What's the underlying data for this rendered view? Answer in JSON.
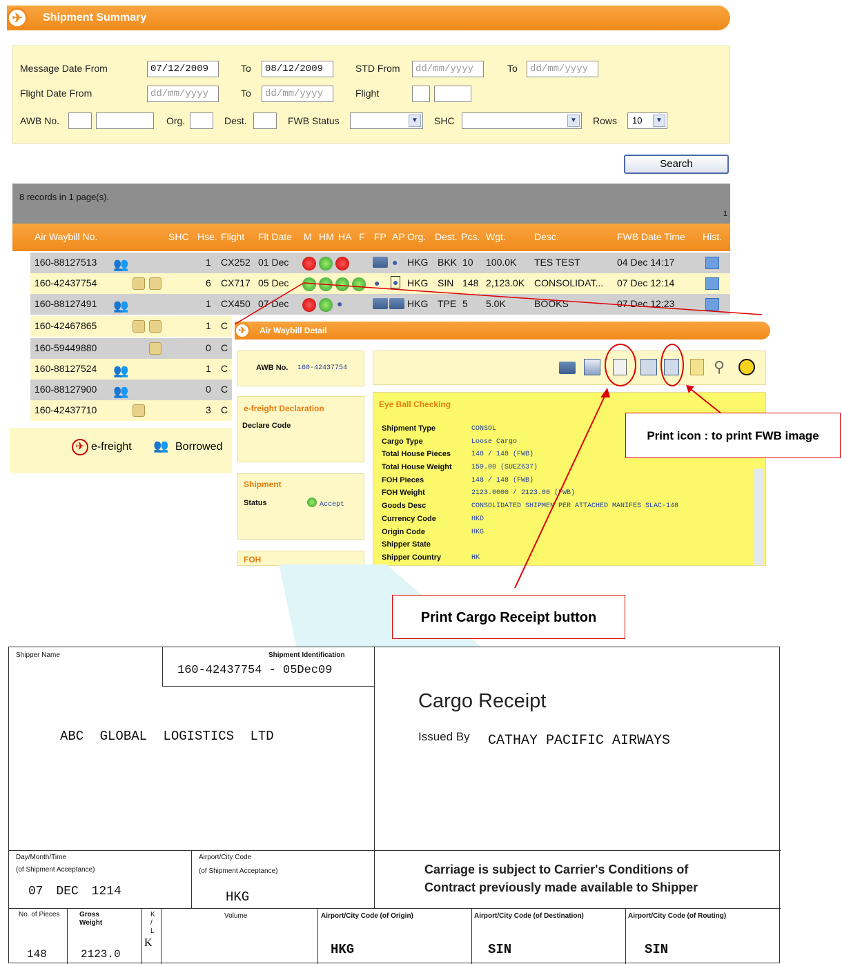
{
  "summary": {
    "title": "Shipment Summary",
    "filters": {
      "message_date_from_label": "Message Date From",
      "message_date_from": "07/12/2009",
      "to1_label": "To",
      "message_date_to": "08/12/2009",
      "std_from_label": "STD From",
      "date_placeholder": "dd/mm/yyyy",
      "to2_label": "To",
      "flight_date_from_label": "Flight Date From",
      "to3_label": "To",
      "flight_label": "Flight",
      "awb_no_label": "AWB No.",
      "org_label": "Org.",
      "dest_label": "Dest.",
      "fwb_status_label": "FWB Status",
      "shc_label": "SHC",
      "rows_label": "Rows",
      "rows_value": "10"
    },
    "search_label": "Search",
    "records_text": "8 records in 1 page(s).",
    "page_number": "1",
    "columns": [
      "Air Waybill No.",
      "SHC",
      "Hse.",
      "Flight",
      "Flt Date",
      "M",
      "HM",
      "HA",
      "F",
      "FP",
      "AP",
      "Org.",
      "Dest.",
      "Pcs.",
      "Wgt.",
      "Desc.",
      "FWB Date Time",
      "Hist."
    ],
    "rows": [
      {
        "awb": "160-88127513",
        "hse": "1",
        "flight": "CX252",
        "date": "01 Dec",
        "org": "HKG",
        "dest": "BKK",
        "pcs": "10",
        "wgt": "100.0K",
        "desc": "TES TEST",
        "fwb": "04 Dec 14:17"
      },
      {
        "awb": "160-42437754",
        "hse": "6",
        "flight": "CX717",
        "date": "05 Dec",
        "org": "HKG",
        "dest": "SIN",
        "pcs": "148",
        "wgt": "2,123.0K",
        "desc": "CONSOLIDAT...",
        "fwb": "07 Dec 12:14"
      },
      {
        "awb": "160-88127491",
        "hse": "1",
        "flight": "CX450",
        "date": "07 Dec",
        "org": "HKG",
        "dest": "TPE",
        "pcs": "5",
        "wgt": "5.0K",
        "desc": "BOOKS",
        "fwb": "07 Dec 12:23"
      },
      {
        "awb": "160-42467865",
        "hse": "1",
        "flight": "C"
      },
      {
        "awb": "160-59449880",
        "hse": "0",
        "flight": "C"
      },
      {
        "awb": "160-88127524",
        "hse": "1",
        "flight": "C"
      },
      {
        "awb": "160-88127900",
        "hse": "0",
        "flight": "C"
      },
      {
        "awb": "160-42437710",
        "hse": "3",
        "flight": "C"
      }
    ],
    "legend": {
      "efreight": "e-freight",
      "borrowed": "Borrowed"
    }
  },
  "detail": {
    "title": "Air Waybill Detail",
    "awb_label": "AWB No.",
    "awb_value": "160-42437754",
    "efreight_title": "e-freight Declaration",
    "declare_code_label": "Declare Code",
    "shipment_title": "Shipment",
    "status_label": "Status",
    "status_value": "Accept",
    "foh_title": "FOH",
    "eyeball_title": "Eye Ball Checking",
    "fields": [
      {
        "label": "Shipment Type",
        "value": "CONSOL"
      },
      {
        "label": "Cargo Type",
        "value": "Loose Cargo"
      },
      {
        "label": "Total House Pieces",
        "value": "148 / 148 (FWB)"
      },
      {
        "label": "Total House Weight",
        "value": "159.00 (SUEZ637)"
      },
      {
        "label": "FOH Pieces",
        "value": "148 / 148 (FWB)"
      },
      {
        "label": "FOH Weight",
        "value": "2123.0000 / 2123.00 (FWB)"
      },
      {
        "label": "Goods Desc",
        "value": "CONSOLIDATED SHIPMEN PER ATTACHED MANIFES SLAC-148"
      },
      {
        "label": "Currency Code",
        "value": "HKD"
      },
      {
        "label": "Origin Code",
        "value": "HKG"
      },
      {
        "label": "Shipper State",
        "value": ""
      },
      {
        "label": "Shipper Country",
        "value": "HK"
      }
    ]
  },
  "annotations": {
    "print_icon_note": "Print icon : to print FWB image",
    "print_receipt_note": "Print Cargo Receipt button"
  },
  "receipt": {
    "shipper_name_label": "Shipper Name",
    "shipment_id_label": "Shipment Identification",
    "shipment_id": "160-42437754 - 05Dec09",
    "shipper_name": "ABC GLOBAL LOGISTICS LTD",
    "title": "Cargo Receipt",
    "issued_by_label": "Issued By",
    "issued_by": "CATHAY PACIFIC AIRWAYS",
    "day_label": "Day/Month/Time",
    "day_sub": "(of Shipment Acceptance)",
    "day_value": "07 DEC 1214",
    "airport_label": "Airport/City Code",
    "airport_sub": "(of Shipment Acceptance)",
    "airport_value": "HKG",
    "carriage_line1": "Carriage is subject to Carrier's Conditions of",
    "carriage_line2": "Contract previously made available to Shipper",
    "pieces_label": "No. of Pieces",
    "gross_label": "Gross Weight",
    "kl_label": "K / L",
    "volume_label": "Volume",
    "origin_label": "Airport/City Code (of Origin)",
    "destination_label": "Airport/City Code (of Destination)",
    "routing_label": "Airport/City Code (of Routing)",
    "pieces": "148",
    "gross": "2123.0",
    "kl": "K",
    "origin": "HKG",
    "destination": "SIN",
    "routing": "SIN"
  }
}
